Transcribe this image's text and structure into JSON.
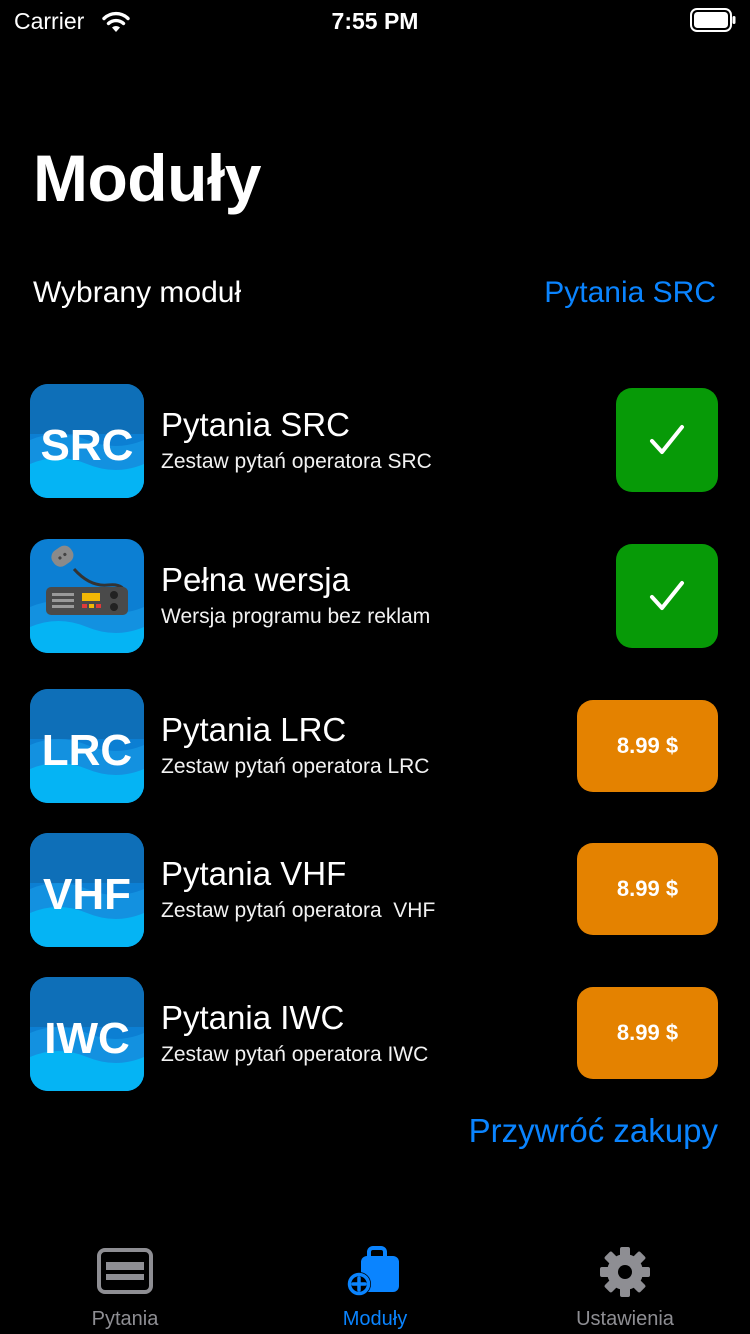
{
  "status_bar": {
    "carrier": "Carrier",
    "time": "7:55 PM"
  },
  "header": {
    "title": "Moduły"
  },
  "selected_module": {
    "label": "Wybrany moduł",
    "value": "Pytania SRC"
  },
  "modules": [
    {
      "icon_text": "SRC",
      "icon": "src-badge",
      "title": "Pytania SRC",
      "subtitle": "Zestaw pytań operatora SRC",
      "status": "owned"
    },
    {
      "icon_text": "",
      "icon": "radio-transceiver",
      "title": "Pełna wersja",
      "subtitle": "Wersja programu bez reklam",
      "status": "owned"
    },
    {
      "icon_text": "LRC",
      "icon": "lrc-badge",
      "title": "Pytania LRC",
      "subtitle": "Zestaw pytań operatora LRC",
      "status": "purchase",
      "price": "8.99 $"
    },
    {
      "icon_text": "VHF",
      "icon": "vhf-badge",
      "title": "Pytania VHF",
      "subtitle": "Zestaw pytań operatora  VHF",
      "status": "purchase",
      "price": "8.99 $"
    },
    {
      "icon_text": "IWC",
      "icon": "iwc-badge",
      "title": "Pytania IWC",
      "subtitle": "Zestaw pytań operatora IWC",
      "status": "purchase",
      "price": "8.99 $"
    }
  ],
  "restore_label": "Przywróć zakupy",
  "tabs": [
    {
      "label": "Pytania",
      "icon": "card-icon",
      "active": false
    },
    {
      "label": "Moduły",
      "icon": "bag-plus-icon",
      "active": true
    },
    {
      "label": "Ustawienia",
      "icon": "gear-icon",
      "active": false
    }
  ],
  "colors": {
    "accent": "#0a84ff",
    "owned": "#079a07",
    "price": "#e48200",
    "inactive_tab": "#8e8e93"
  }
}
